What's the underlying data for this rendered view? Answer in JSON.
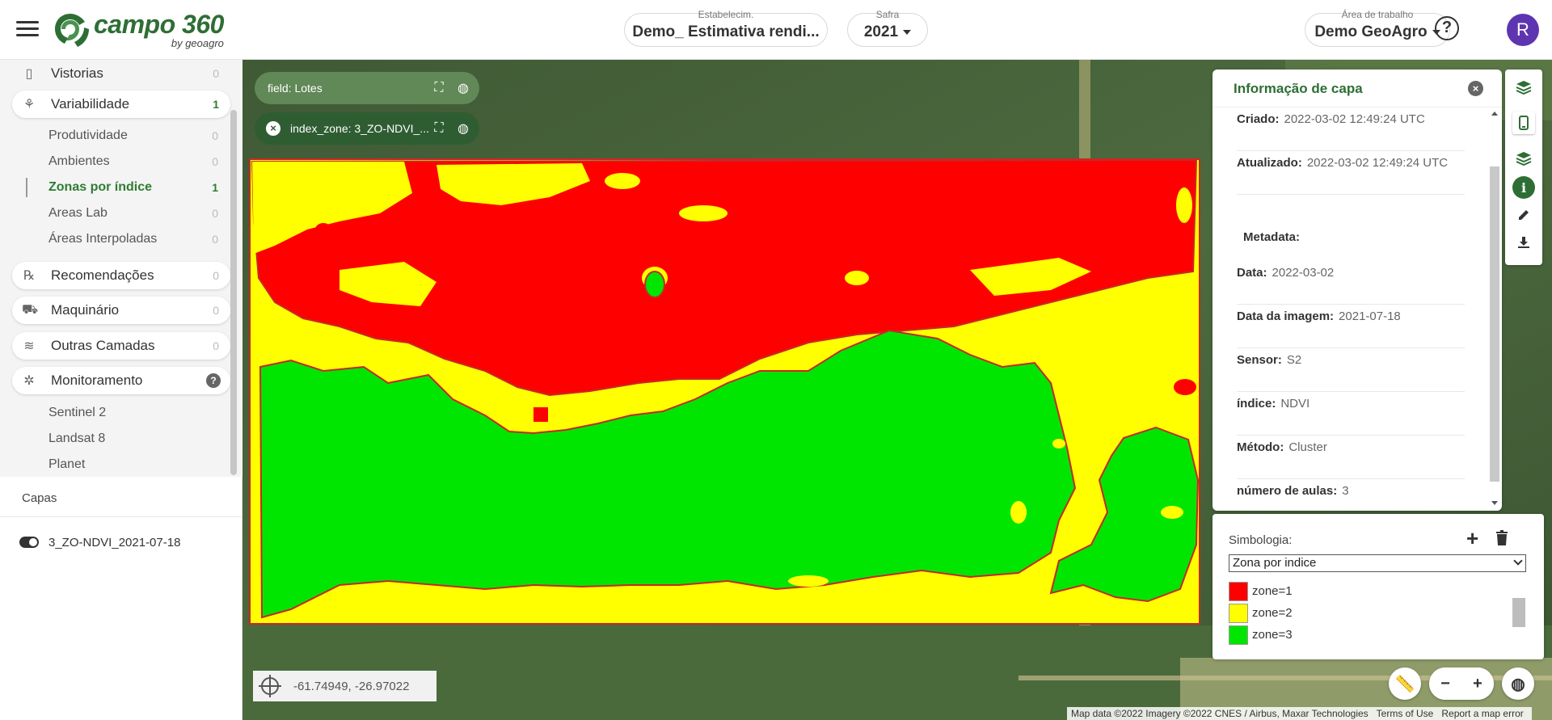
{
  "header": {
    "logo_main": "campo 360",
    "logo_sub": "by geoagro",
    "establishment": {
      "caption": "Estabelecim.",
      "value": "Demo_ Estimativa rendi..."
    },
    "safra": {
      "caption": "Safra",
      "value": "2021"
    },
    "workspace": {
      "caption": "Área de trabalho",
      "value": "Demo GeoAgro"
    },
    "help_label": "?",
    "avatar_initial": "R"
  },
  "sidebar": {
    "items": [
      {
        "label": "Vistorias",
        "count": "0"
      },
      {
        "label": "Variabilidade",
        "count": "1"
      },
      {
        "label": "Recomendações",
        "count": "0"
      },
      {
        "label": "Maquinário",
        "count": "0"
      },
      {
        "label": "Outras Camadas",
        "count": "0"
      },
      {
        "label": "Monitoramento",
        "count": "?"
      }
    ],
    "variabilidade_sub": [
      {
        "label": "Produtividade",
        "count": "0"
      },
      {
        "label": "Ambientes",
        "count": "0"
      },
      {
        "label": "Zonas por índice",
        "count": "1"
      },
      {
        "label": "Areas Lab",
        "count": "0"
      },
      {
        "label": "Áreas Interpoladas",
        "count": "0"
      }
    ],
    "monitoramento_sub": [
      {
        "label": "Sentinel 2"
      },
      {
        "label": "Landsat 8"
      },
      {
        "label": "Planet"
      }
    ],
    "capas_title": "Capas",
    "layer_name": "3_ZO-NDVI_2021-07-18"
  },
  "map": {
    "chip_field": "field: Lotes",
    "chip_layer": "index_zone: 3_ZO-NDVI_...",
    "coordinates": "-61.74949, -26.97022",
    "attribution": "Map data ©2022 Imagery ©2022 CNES / Airbus, Maxar Technologies",
    "terms": "Terms of Use",
    "report": "Report a map error",
    "zoom_out": "−",
    "zoom_in": "+",
    "colors": {
      "zone1": "#ff0000",
      "zone2": "#ffff00",
      "zone3": "#00e600",
      "outline": "#c62828"
    }
  },
  "info": {
    "title": "Informação de capa",
    "rows": [
      {
        "key": "Criado:",
        "value": "2022-03-02 12:49:24 UTC"
      },
      {
        "key": "Atualizado:",
        "value": "2022-03-02 12:49:24 UTC"
      },
      {
        "key": "Metadata:",
        "value": ""
      },
      {
        "key": "Data:",
        "value": "2022-03-02"
      },
      {
        "key": "Data da imagem:",
        "value": "2021-07-18"
      },
      {
        "key": "Sensor:",
        "value": "S2"
      },
      {
        "key": "índice:",
        "value": "NDVI"
      },
      {
        "key": "Método:",
        "value": "Cluster"
      },
      {
        "key": "número de aulas:",
        "value": "3"
      }
    ]
  },
  "symbology": {
    "label": "Simbologia:",
    "selected": "Zona por indice",
    "legend": [
      {
        "label": "zone=1",
        "color": "#ff0000"
      },
      {
        "label": "zone=2",
        "color": "#ffff00"
      },
      {
        "label": "zone=3",
        "color": "#00e600"
      }
    ]
  },
  "brand_color": "#2e6e35"
}
